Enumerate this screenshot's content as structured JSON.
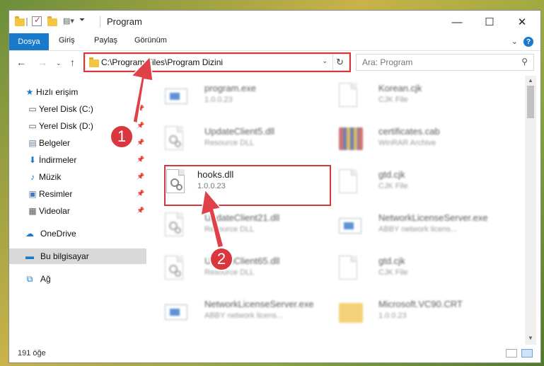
{
  "window": {
    "title": "Program",
    "controls": {
      "minimize": "—",
      "maximize": "☐",
      "close": "✕"
    }
  },
  "ribbon": {
    "tabs": [
      {
        "label": "Dosya"
      },
      {
        "label": "Giriş"
      },
      {
        "label": "Paylaş"
      },
      {
        "label": "Görünüm"
      }
    ],
    "help_label": "?"
  },
  "address": {
    "path": "C:\\Program Files\\Program Dizini"
  },
  "search": {
    "placeholder": "Ara: Program"
  },
  "sidebar": {
    "items": [
      {
        "label": "Hızlı erişim",
        "icon": "star-icon"
      },
      {
        "label": "Yerel Disk (C:)",
        "icon": "drive-icon"
      },
      {
        "label": "Yerel Disk (D:)",
        "icon": "drive-icon"
      },
      {
        "label": "Belgeler",
        "icon": "documents-icon"
      },
      {
        "label": "İndirmeler",
        "icon": "download-icon"
      },
      {
        "label": "Müzik",
        "icon": "music-icon"
      },
      {
        "label": "Resimler",
        "icon": "pictures-icon"
      },
      {
        "label": "Videolar",
        "icon": "videos-icon"
      },
      {
        "label": "OneDrive",
        "icon": "cloud-icon"
      },
      {
        "label": "Bu bilgisayar",
        "icon": "computer-icon"
      },
      {
        "label": "Ağ",
        "icon": "network-icon"
      }
    ]
  },
  "files": [
    {
      "name": "program.exe",
      "sub": "1.0.0.23"
    },
    {
      "name": "Korean.cjk",
      "sub": "CJK File"
    },
    {
      "name": "UpdateClient5.dll",
      "sub": "Resource DLL"
    },
    {
      "name": "certificates.cab",
      "sub": "WinRAR Archive"
    },
    {
      "name": "hooks.dll",
      "sub": "1.0.0.23"
    },
    {
      "name": "gtd.cjk",
      "sub": "CJK File"
    },
    {
      "name": "UpdateClient21.dll",
      "sub": "Resource DLL"
    },
    {
      "name": "NetworkLicenseServer.exe",
      "sub": "ABBY network licens..."
    },
    {
      "name": "UpdateClient65.dll",
      "sub": "Resource DLL"
    },
    {
      "name": "gtd.cjk",
      "sub": "CJK File"
    },
    {
      "name": "NetworkLicenseServer.exe",
      "sub": "ABBY network licens..."
    },
    {
      "name": "Microsoft.VC90.CRT",
      "sub": "1.0.0.23"
    }
  ],
  "annotations": {
    "step1": "1",
    "step2": "2"
  },
  "status": {
    "count": "191 öğe"
  },
  "colors": {
    "accent": "#1979ca",
    "highlight": "#d9363e"
  }
}
